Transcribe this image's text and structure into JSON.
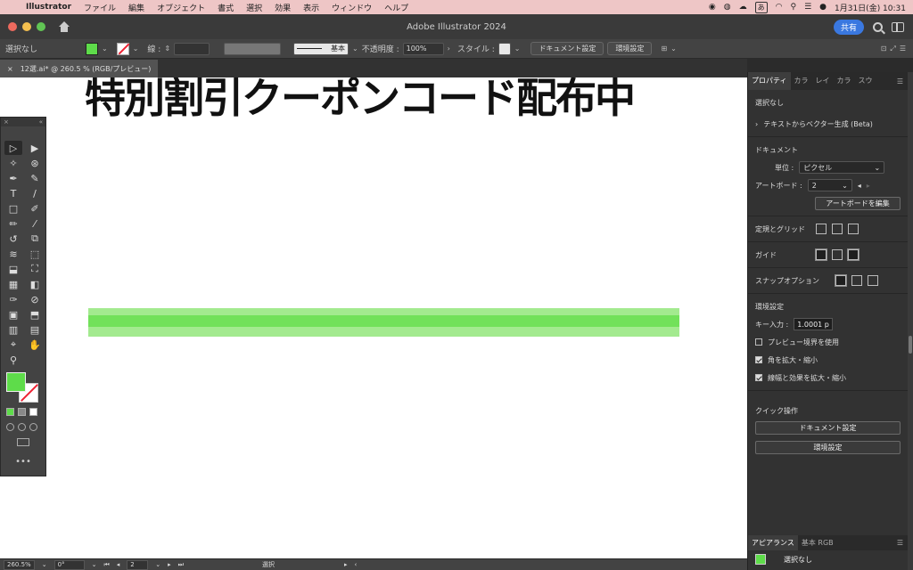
{
  "menubar": {
    "apple": "",
    "items": [
      "Illustrator",
      "ファイル",
      "編集",
      "オブジェクト",
      "書式",
      "選択",
      "効果",
      "表示",
      "ウィンドウ",
      "ヘルプ"
    ],
    "clock": "1月31日(金)  10:31",
    "ime": "あ"
  },
  "titlebar": {
    "title": "Adobe Illustrator 2024",
    "share": "共有"
  },
  "controlbar": {
    "selection": "選択なし",
    "stroke_label": "線 :",
    "brush_label": "基本",
    "opacity_label": "不透明度 :",
    "opacity_value": "100%",
    "style_label": "スタイル :",
    "doc_settings": "ドキュメント設定",
    "prefs": "環境設定"
  },
  "document": {
    "tab_close": "×",
    "tab_label": "12選.ai* @ 260.5 % (RGB/プレビュー)"
  },
  "canvas": {
    "heading": "特別割引クーポンコード配布中",
    "fill_color": "#5edc4a"
  },
  "toolbar": {
    "collapse": "«",
    "close": "×",
    "tools": [
      "▷",
      "▶",
      "✧",
      "⊛",
      "✒",
      "✎",
      "T",
      "/",
      "□",
      "✐",
      "✏",
      "⁄",
      "↺",
      "⧉",
      "≋",
      "⬚",
      "⬓",
      "⛶",
      "▦",
      "◧",
      "✑",
      "⊘",
      "▣",
      "⬒",
      "▥",
      "▤",
      "⌖",
      "✋",
      "⚲"
    ],
    "more": "•••"
  },
  "properties": {
    "tabs": [
      "プロパティ",
      "カラ",
      "レイ",
      "カラ",
      "スウ"
    ],
    "selection": "選択なし",
    "text_to_vector": "テキストからベクター生成 (Beta)",
    "document_heading": "ドキュメント",
    "units_label": "単位 :",
    "units_value": "ピクセル",
    "artboard_label": "アートボード :",
    "artboard_value": "2",
    "edit_artboards": "アートボードを編集",
    "rulers_grids": "定規とグリッド",
    "guides": "ガイド",
    "snap_options": "スナップオプション",
    "prefs_heading": "環境設定",
    "key_increment_label": "キー入力 :",
    "key_increment_value": "1.0001 p",
    "preview_bounds": "プレビュー境界を使用",
    "scale_corners": "角を拡大・縮小",
    "scale_strokes": "線幅と効果を拡大・縮小",
    "quick_actions": "クイック操作",
    "doc_settings_btn": "ドキュメント設定",
    "prefs_btn": "環境設定"
  },
  "appearance": {
    "tabs": [
      "アピアランス",
      "基本 RGB"
    ],
    "selection": "選択なし"
  },
  "statusbar": {
    "zoom": "260.5%",
    "rotation": "0°",
    "artboard": "2",
    "tool": "選択"
  }
}
